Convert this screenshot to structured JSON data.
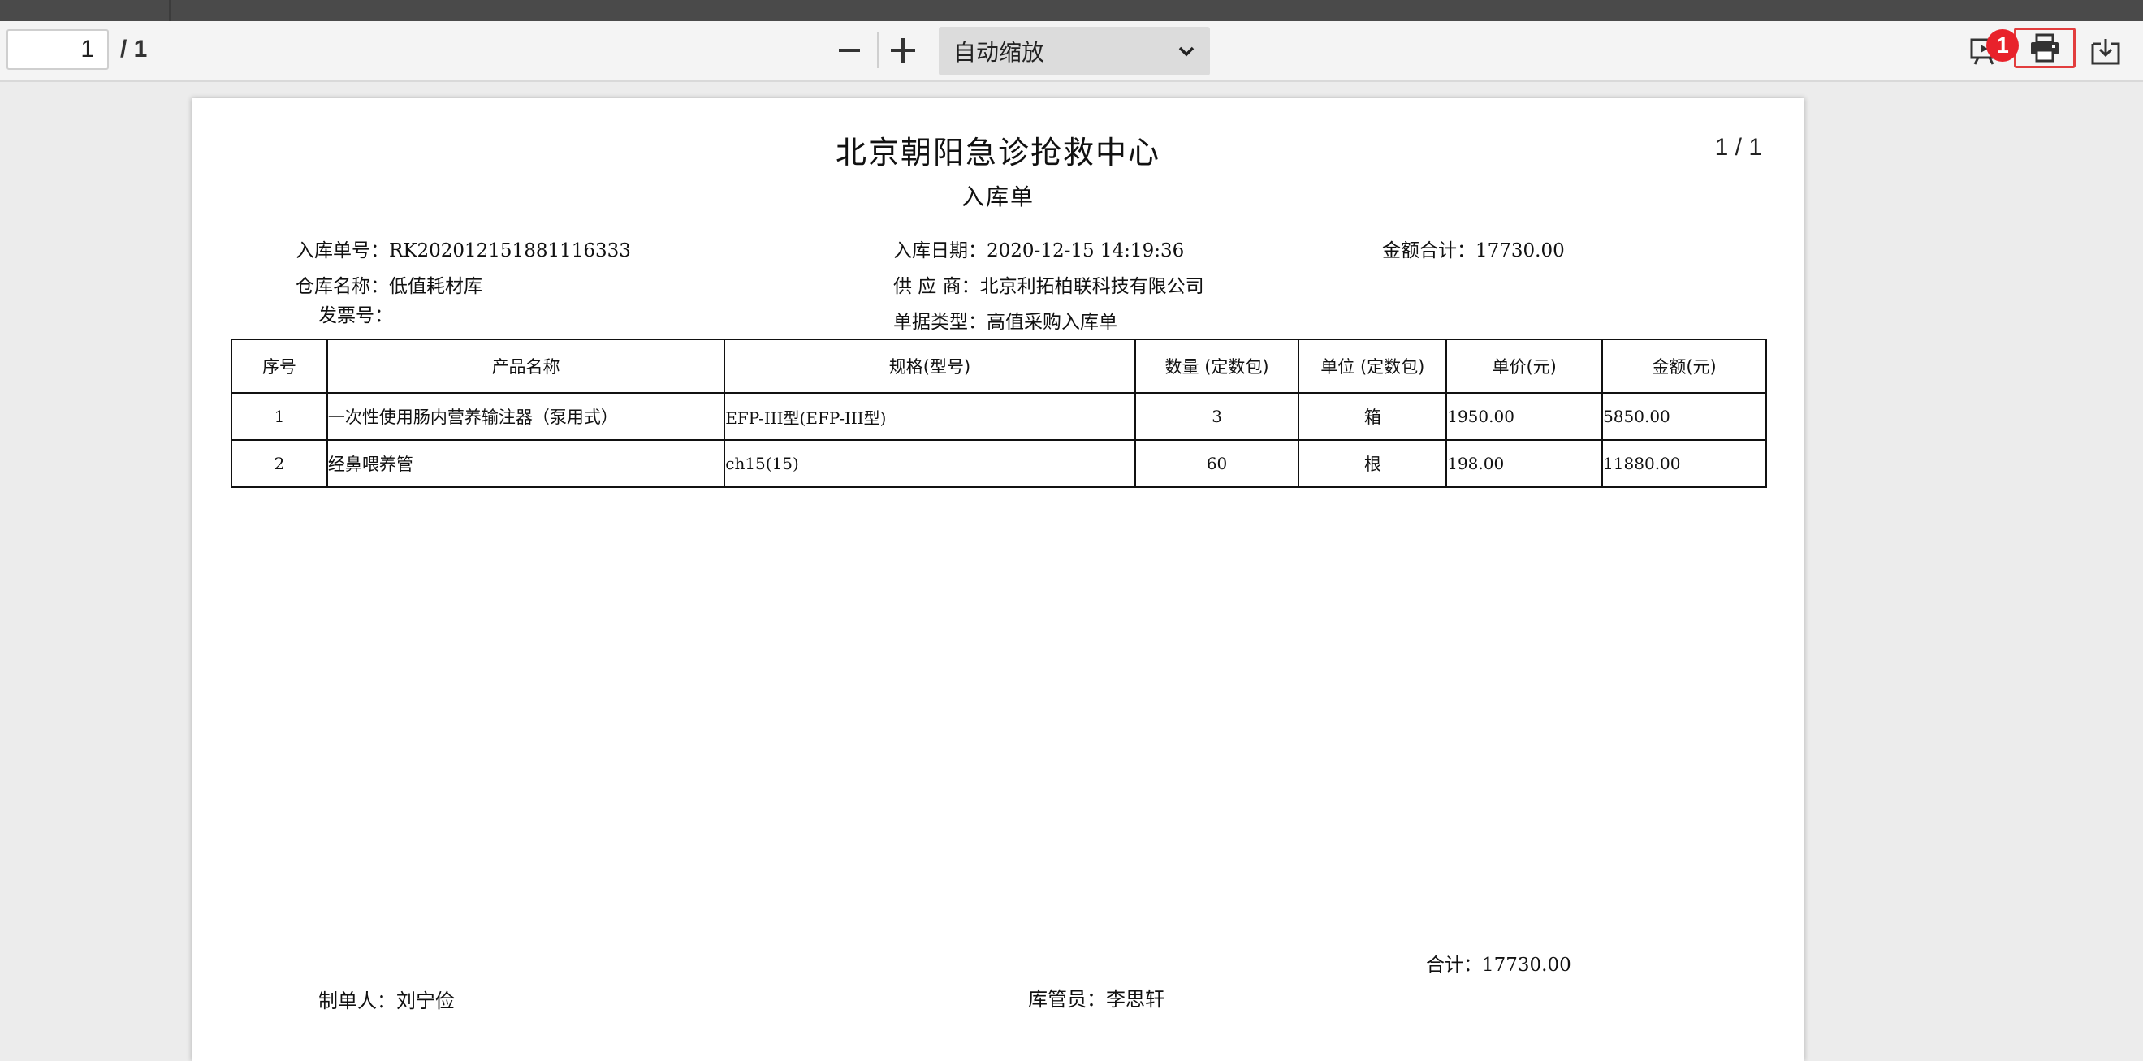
{
  "toolbar": {
    "page_current": "1",
    "page_total": "/ 1",
    "zoom_out_icon": "minus-icon",
    "zoom_in_icon": "plus-icon",
    "zoom_label": "自动缩放",
    "present_icon": "presentation-icon",
    "print_icon": "printer-icon",
    "save_icon": "download-icon",
    "badge": "1",
    "highlight_color": "#e23d3d",
    "badge_color": "#e8222b"
  },
  "document": {
    "title": "北京朝阳急诊抢救中心",
    "page_indicator": "1  /  1",
    "subtitle": "入库单",
    "fields": {
      "order_no_label": "入库单号：",
      "order_no": "RK202012151881116333",
      "date_label": "入库日期：",
      "date": "2020-12-15 14:19:36",
      "amount_label": "金额合计：",
      "amount": "17730.00",
      "warehouse_label": "仓库名称：",
      "warehouse": "低值耗材库",
      "supplier_label": "供 应 商：",
      "supplier": "北京利拓柏联科技有限公司",
      "invoice_label": "发票号：",
      "invoice": "",
      "doc_type_label": "单据类型：",
      "doc_type": "高值采购入库单"
    },
    "table": {
      "headers": [
        "序号",
        "产品名称",
        "规格(型号)",
        "数量 (定数包)",
        "单位 (定数包)",
        "单价(元)",
        "金额(元)"
      ],
      "rows": [
        [
          "1",
          "一次性使用肠内营养输注器（泵用式）",
          "EFP-III型(EFP-III型)",
          "3",
          "箱",
          "1950.00",
          "5850.00"
        ],
        [
          "2",
          "经鼻喂养管",
          "ch15(15)",
          "60",
          "根",
          "198.00",
          "11880.00"
        ]
      ]
    },
    "total_label": "合计：",
    "total_value": "17730.00",
    "maker_label": "制单人：",
    "maker": "刘宁俭",
    "keeper_label": "库管员：",
    "keeper": "李思轩"
  }
}
